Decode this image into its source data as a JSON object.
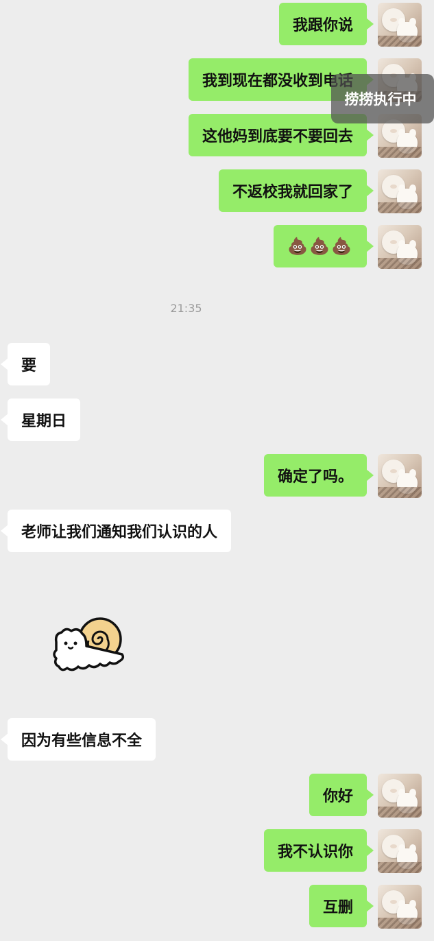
{
  "messages": [
    {
      "side": "me",
      "text": "我跟你说"
    },
    {
      "side": "me",
      "text": "我到现在都没收到电话"
    },
    {
      "side": "me",
      "text": "这他妈到底要不要回去"
    },
    {
      "side": "me",
      "text": "不返校我就回家了"
    },
    {
      "side": "me",
      "text": "💩💩💩"
    },
    {
      "side": "them",
      "text": "要"
    },
    {
      "side": "them",
      "text": "星期日"
    },
    {
      "side": "me",
      "text": "确定了吗。"
    },
    {
      "side": "them",
      "text": "老师让我们通知我们认识的人"
    },
    {
      "side": "them",
      "text": "因为有些信息不全"
    },
    {
      "side": "me",
      "text": "你好"
    },
    {
      "side": "me",
      "text": "我不认识你"
    },
    {
      "side": "me",
      "text": "互删"
    }
  ],
  "timestamp": "21:35",
  "overlay": {
    "text": "捞捞执行中"
  },
  "sticker": {
    "icon": "snail-cat-sticker"
  },
  "colors": {
    "background": "#ededed",
    "my_bubble": "#95ec69",
    "their_bubble": "#ffffff"
  }
}
